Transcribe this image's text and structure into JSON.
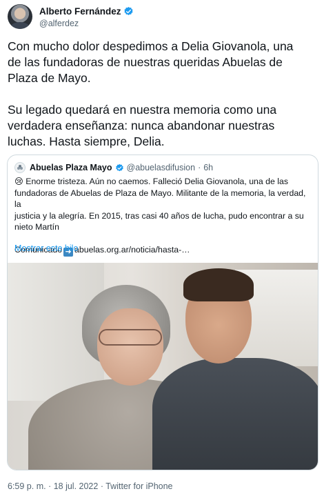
{
  "author": {
    "name": "Alberto Fernández",
    "handle": "@alferdez"
  },
  "tweet": {
    "text": "Con mucho dolor despedimos a Delia Giovanola, una\nde las fundadoras de nuestras queridas Abuelas de\nPlaza de Mayo.\n\nSu legado quedará en nuestra memoria como una\nverdadera enseñanza: nunca abandonar nuestras\nluchas. Hasta siempre, Delia."
  },
  "quoted": {
    "name": "Abuelas Plaza Mayo",
    "handle": "@abuelasdifusion",
    "separator": "·",
    "time": "6h",
    "text_emoji": "😢",
    "text_main": " Enorme tristeza. Aún no caemos. Falleció Delia Giovanola, una de las\nfundadoras de Abuelas de Plaza de Mayo. Militante de la memoria, la verdad, la\njusticia y la alegría. En 2015, tras casi 40 años de lucha, pudo encontrar a su\nnieto Martín\n\nComunicado",
    "link_text": "abuelas.org.ar/noticia/hasta-…",
    "show_thread": "Mostrar este hilo"
  },
  "footer": {
    "timestamp": "6:59 p. m. · 18 jul. 2022",
    "separator": " · ",
    "source": "Twitter for iPhone"
  },
  "colors": {
    "accent": "#1d9bf0",
    "verified": "#1d9bf0",
    "secondary_text": "#536471"
  },
  "icons": {
    "verified": "verified-badge-icon",
    "arrow": "right-arrow-icon"
  }
}
